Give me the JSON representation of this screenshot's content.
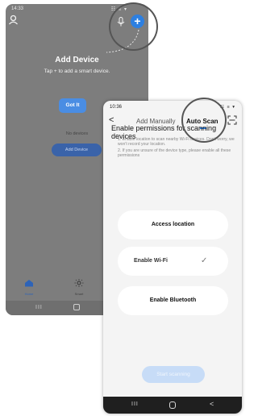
{
  "phone1": {
    "status_time": "14:33",
    "status_icons": "☷ ≡ ▾",
    "title": "Add Device",
    "subtitle": "Tap + to add a smart device.",
    "got_it": "Got It",
    "no_devices": "No devices",
    "add_device_button": "Add Device",
    "tabs": [
      {
        "label": "Home",
        "icon": "home-icon"
      },
      {
        "label": "Smart",
        "icon": "sun-icon"
      }
    ],
    "nav_recent": "III"
  },
  "phone2": {
    "status_time": "10:36",
    "status_icons": "☷ ≡ ▾",
    "tabs": {
      "manual": "Add Manually",
      "auto": "Auto Scan"
    },
    "title": "Enable permissions for scanning devices",
    "note1": "1. Enable location to scan nearby Wi-Fi devices. Don't worry, we won't record your location.",
    "note2": "2. If you are unsure of the device type, please enable all these permissions",
    "buttons": {
      "location": "Access location",
      "wifi": "Enable Wi-Fi",
      "bluetooth": "Enable Bluetooth"
    },
    "wifi_check": "✓",
    "start_scanning": "Start scanning",
    "nav": {
      "recent": "III",
      "back": "<"
    }
  },
  "colors": {
    "accent": "#2d7fe0",
    "dim_overlay": "#7d7d7d"
  }
}
